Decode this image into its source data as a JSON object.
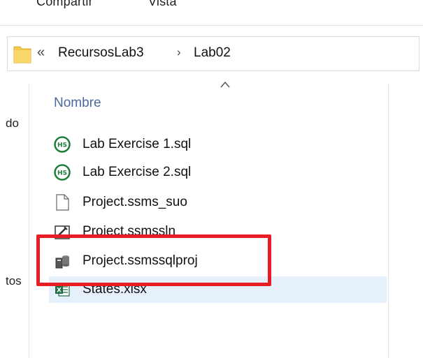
{
  "ribbon": {
    "tabs": [
      {
        "label": "Compartir"
      },
      {
        "label": "Vista"
      }
    ]
  },
  "address_bar": {
    "overflow_glyph": "«",
    "path": [
      "RecursosLab3",
      "Lab02"
    ],
    "separator": "›",
    "icon": "folder-icon"
  },
  "navigation": {
    "fragments": [
      "do",
      "tos"
    ]
  },
  "file_list": {
    "column_header": "Nombre",
    "sort": "ascending",
    "files": [
      {
        "name": "Lab Exercise 1.sql",
        "icon": "ssms-sql-file-icon",
        "selected": false
      },
      {
        "name": "Lab Exercise 2.sql",
        "icon": "ssms-sql-file-icon",
        "selected": false
      },
      {
        "name": "Project.ssms_suo",
        "icon": "blank-file-icon",
        "selected": false
      },
      {
        "name": "Project.ssmssln",
        "icon": "ssms-solution-file-icon",
        "selected": false
      },
      {
        "name": "Project.ssmssqlproj",
        "icon": "ssms-project-file-icon",
        "selected": false
      },
      {
        "name": "States.xlsx",
        "icon": "excel-file-icon",
        "selected": true
      }
    ]
  },
  "colors": {
    "header_text": "#4a6a9a",
    "selection": "#e5f0fb",
    "highlight_border": "#e81c24",
    "folder": "#f5c94e"
  }
}
